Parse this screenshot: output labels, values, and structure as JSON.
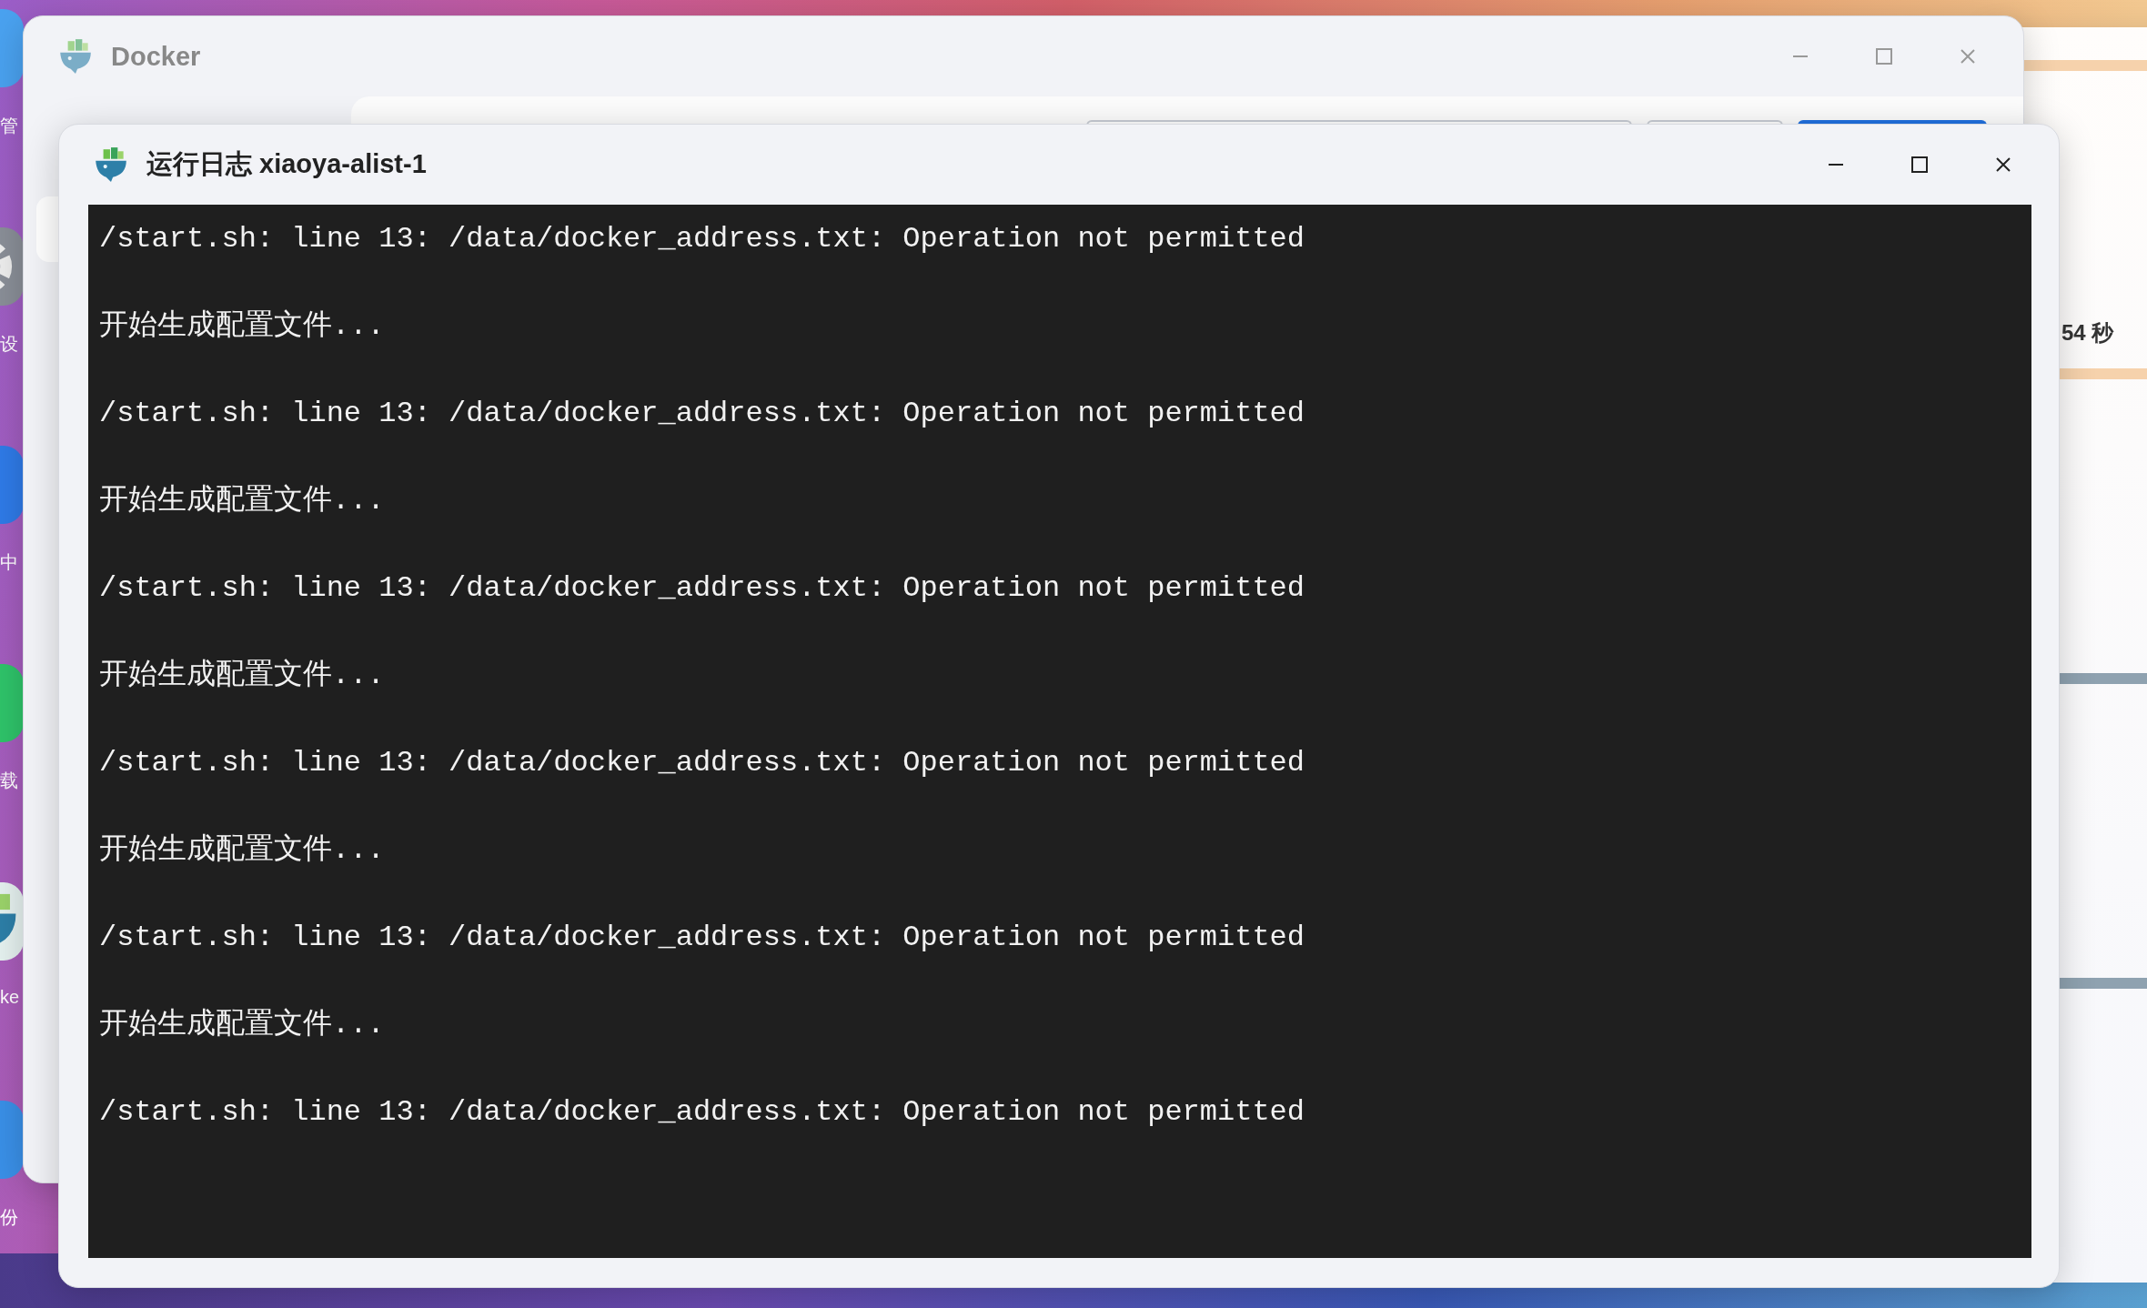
{
  "desktop": {
    "icons": [
      {
        "kind": "folder",
        "label": "管"
      },
      {
        "kind": "gear",
        "label": "设"
      },
      {
        "kind": "blue",
        "label": "中"
      },
      {
        "kind": "download",
        "label": "载"
      },
      {
        "kind": "whale",
        "label": "ke"
      },
      {
        "kind": "backup",
        "label": "份"
      }
    ]
  },
  "background_window": {
    "text": "54 秒"
  },
  "docker_window": {
    "title": "Docker"
  },
  "log_window": {
    "title": "运行日志 xiaoya-alist-1",
    "lines": [
      "/start.sh: line 13: /data/docker_address.txt: Operation not permitted",
      "开始生成配置文件...",
      "/start.sh: line 13: /data/docker_address.txt: Operation not permitted",
      "开始生成配置文件...",
      "/start.sh: line 13: /data/docker_address.txt: Operation not permitted",
      "开始生成配置文件...",
      "/start.sh: line 13: /data/docker_address.txt: Operation not permitted",
      "开始生成配置文件...",
      "/start.sh: line 13: /data/docker_address.txt: Operation not permitted",
      "开始生成配置文件...",
      "/start.sh: line 13: /data/docker_address.txt: Operation not permitted"
    ]
  }
}
